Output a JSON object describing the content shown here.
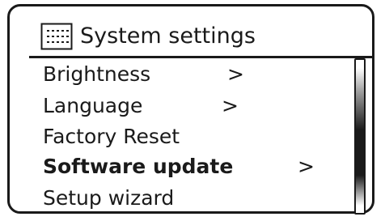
{
  "header": {
    "title": "System settings",
    "icon": "menu-grid-icon"
  },
  "menu": {
    "items": [
      {
        "label": "Brightness",
        "arrow": ">",
        "selected": false
      },
      {
        "label": "Language",
        "arrow": ">",
        "selected": false
      },
      {
        "label": "Factory Reset",
        "arrow": "",
        "selected": false
      },
      {
        "label": "Software update",
        "arrow": ">",
        "selected": true
      },
      {
        "label": "Setup wizard",
        "arrow": "",
        "selected": false
      }
    ]
  },
  "scrollbar": {
    "position_fraction": 0.55,
    "visible_fraction": 0.9
  },
  "colors": {
    "foreground": "#1a1a1a",
    "background": "#ffffff"
  }
}
